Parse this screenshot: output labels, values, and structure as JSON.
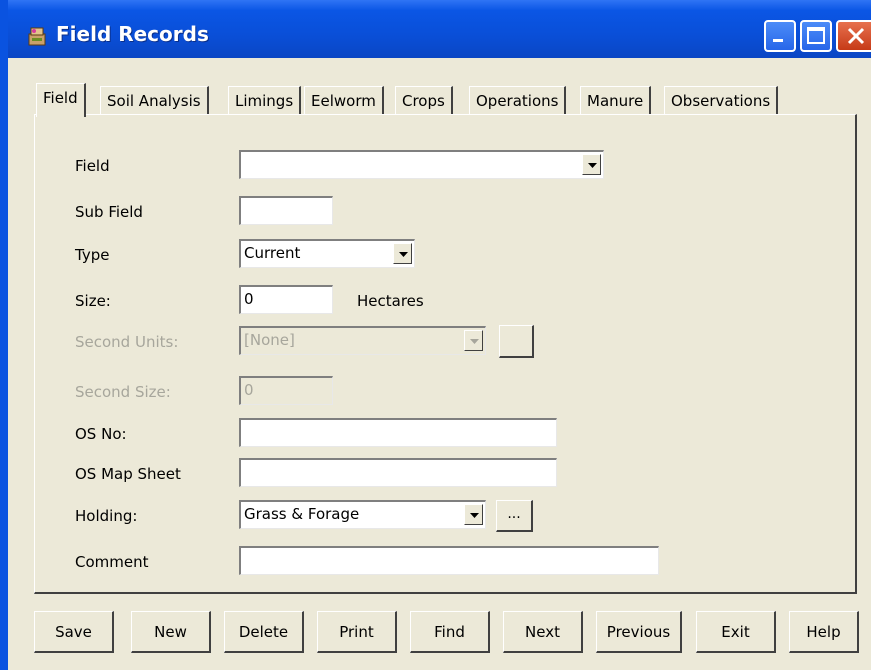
{
  "window": {
    "title": "Field Records",
    "icon": "app-icon"
  },
  "titlebar_buttons": [
    "minimize-icon",
    "maximize-icon",
    "close-icon"
  ],
  "tabs": [
    {
      "label": "Field",
      "active": true
    },
    {
      "label": "Soil Analysis"
    },
    {
      "label": "Limings"
    },
    {
      "label": "Eelworm"
    },
    {
      "label": "Crops"
    },
    {
      "label": "Operations"
    },
    {
      "label": "Manure"
    },
    {
      "label": "Observations"
    }
  ],
  "form": {
    "field": {
      "label": "Field",
      "value": ""
    },
    "sub_field": {
      "label": "Sub Field",
      "value": ""
    },
    "type": {
      "label": "Type",
      "value": "Current"
    },
    "size": {
      "label": "Size:",
      "value": "0",
      "unit": "Hectares"
    },
    "second_units": {
      "label": "Second Units:",
      "value": "[None]"
    },
    "second_size": {
      "label": "Second Size:",
      "value": "0"
    },
    "os_no": {
      "label": "OS No:",
      "value": ""
    },
    "os_map_sheet": {
      "label": "OS Map Sheet",
      "value": ""
    },
    "holding": {
      "label": "Holding:",
      "value": "Grass & Forage",
      "browse": "..."
    },
    "comment": {
      "label": "Comment",
      "value": ""
    }
  },
  "buttons": {
    "save": "Save",
    "new": "New",
    "delete": "Delete",
    "print": "Print",
    "find": "Find",
    "next": "Next",
    "previous": "Previous",
    "exit": "Exit",
    "help": "Help"
  },
  "colors": {
    "titlebar": "#0a4fd8",
    "face": "#ece9d8",
    "close": "#c63a17"
  }
}
